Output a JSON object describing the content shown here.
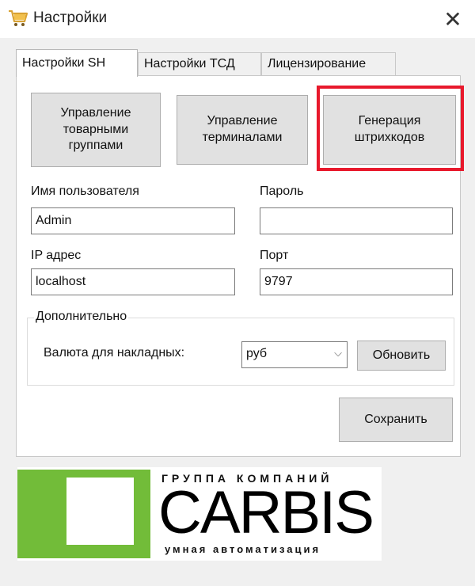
{
  "window": {
    "title": "Настройки",
    "close_glyph": "✕",
    "icon": "cart-icon"
  },
  "tabs": [
    {
      "label": "Настройки SH",
      "active": true
    },
    {
      "label": "Настройки ТСД",
      "active": false
    },
    {
      "label": "Лицензирование",
      "active": false
    }
  ],
  "actions": {
    "groups_label": "Управление\nтоварными\nгруппами",
    "terminals_label": "Управление\nтерминалами",
    "barcodes_label": "Генерация\nштрихкодов"
  },
  "form": {
    "username_label": "Имя пользователя",
    "username_value": "Admin",
    "password_label": "Пароль",
    "password_value": "",
    "ip_label": "IP адрес",
    "ip_value": "localhost",
    "port_label": "Порт",
    "port_value": "9797"
  },
  "extra": {
    "group_label": "Дополнительно",
    "currency_label": "Валюта для накладных:",
    "currency_value": "руб",
    "refresh_label": "Обновить"
  },
  "save_label": "Сохранить",
  "logo": {
    "top_text": "ГРУППА КОМПАНИЙ",
    "main_text": "CARBIS",
    "bottom_text": "умная автоматизация"
  },
  "colors": {
    "highlight": "#e8192c",
    "logo_green": "#72bc39"
  }
}
